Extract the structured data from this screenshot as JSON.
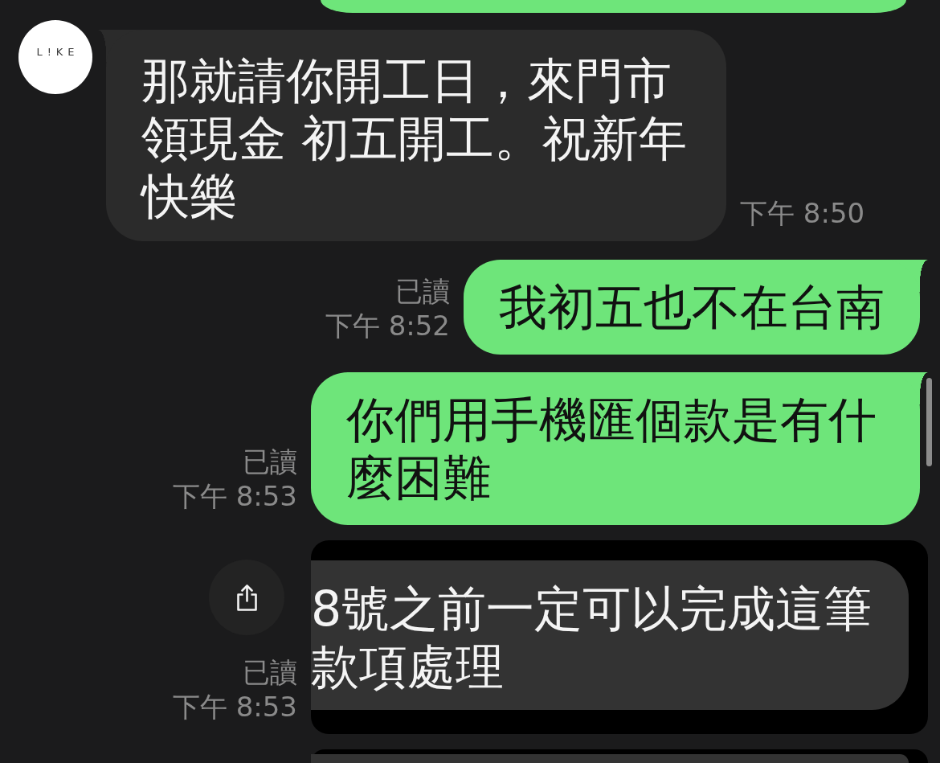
{
  "messages": [
    {
      "kind": "cut_outgoing"
    },
    {
      "kind": "incoming",
      "sender": {
        "logo": "L!KE"
      },
      "text": "那就請你開工日，來門市領現金 初五開工。祝新年快樂",
      "time": "下午 8:50"
    },
    {
      "kind": "outgoing",
      "text": "我初五也不在台南",
      "read": "已讀",
      "time": "下午 8:52"
    },
    {
      "kind": "outgoing",
      "text": "你們用手機匯個款是有什麼困難",
      "read": "已讀",
      "time": "下午 8:53"
    },
    {
      "kind": "highlighted",
      "text": "8號之前一定可以完成這筆款項處理",
      "read": "已讀",
      "time": "下午 8:53"
    },
    {
      "kind": "cut_highlighted"
    }
  ]
}
